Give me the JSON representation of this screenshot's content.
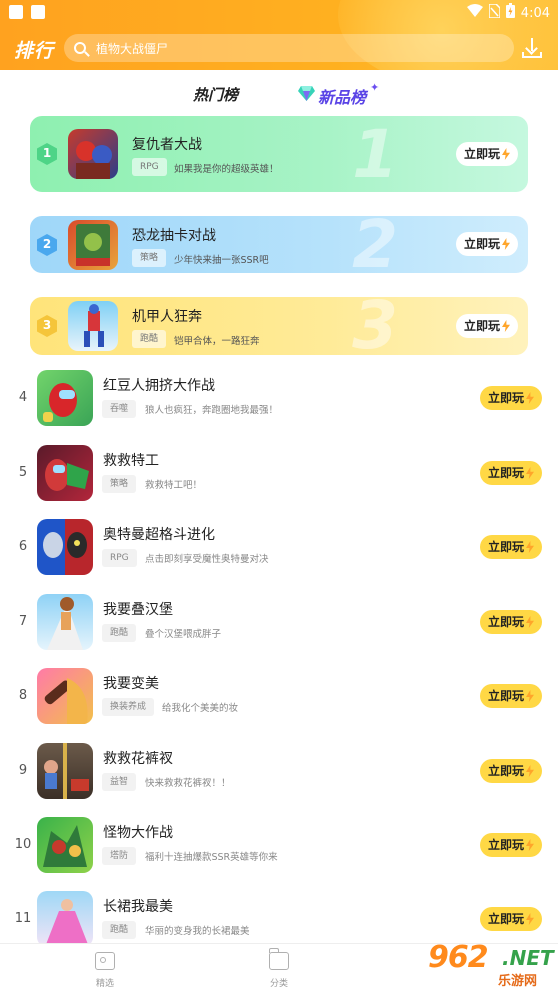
{
  "status_bar": {
    "time": "4:04"
  },
  "header": {
    "title": "排行",
    "search_placeholder": "植物大战僵尸"
  },
  "tabs": [
    {
      "label": "热门榜",
      "active": false
    },
    {
      "label": "新品榜",
      "active": true
    }
  ],
  "top3": [
    {
      "rank": "1",
      "bignum": "1",
      "name": "复仇者大战",
      "tag": "RPG",
      "desc": "如果我是你的超级英雄！",
      "play": "立即玩"
    },
    {
      "rank": "2",
      "bignum": "2",
      "name": "恐龙抽卡对战",
      "tag": "策略",
      "desc": "少年快来抽一张SSR吧",
      "play": "立即玩"
    },
    {
      "rank": "3",
      "bignum": "3",
      "name": "机甲人狂奔",
      "tag": "跑酷",
      "desc": "铠甲合体，一路狂奔",
      "play": "立即玩"
    }
  ],
  "list": [
    {
      "rank": "4",
      "name": "红豆人拥挤大作战",
      "tag": "吞噬",
      "desc": "狼人也疯狂，奔跑圈地我最强！",
      "play": "立即玩"
    },
    {
      "rank": "5",
      "name": "救救特工",
      "tag": "策略",
      "desc": "救救特工吧！",
      "play": "立即玩"
    },
    {
      "rank": "6",
      "name": "奥特曼超格斗进化",
      "tag": "RPG",
      "desc": "点击即刻享受魔性奥特曼对决",
      "play": "立即玩"
    },
    {
      "rank": "7",
      "name": "我要叠汉堡",
      "tag": "跑酷",
      "desc": "叠个汉堡喂成胖子",
      "play": "立即玩"
    },
    {
      "rank": "8",
      "name": "我要变美",
      "tag": "换装养成",
      "desc": "给我化个美美的妆",
      "play": "立即玩"
    },
    {
      "rank": "9",
      "name": "救救花裤衩",
      "tag": "益智",
      "desc": "快来救救花裤衩！！",
      "play": "立即玩"
    },
    {
      "rank": "10",
      "name": "怪物大作战",
      "tag": "塔防",
      "desc": "福利十连抽爆款SSR英雄等你来",
      "play": "立即玩"
    },
    {
      "rank": "11",
      "name": "长裙我最美",
      "tag": "跑酷",
      "desc": "华丽的变身我的长裙最美",
      "play": "立即玩"
    }
  ],
  "bottom_nav": [
    {
      "label": "精选",
      "icon": "gamepad-icon"
    },
    {
      "label": "分类",
      "icon": "folder-icon"
    }
  ],
  "watermark": {
    "main": "962",
    "net": ".NET",
    "sub": "乐游网"
  },
  "colors": {
    "header_orange": "#ffa21f",
    "play_yellow": "#ffd845",
    "bolt_orange": "#ffa52a",
    "card1_green": "#8ef0b0",
    "card2_blue": "#a6dcfa",
    "card3_yellow": "#ffe98a",
    "new_tab_purple": "#5a44e6"
  }
}
